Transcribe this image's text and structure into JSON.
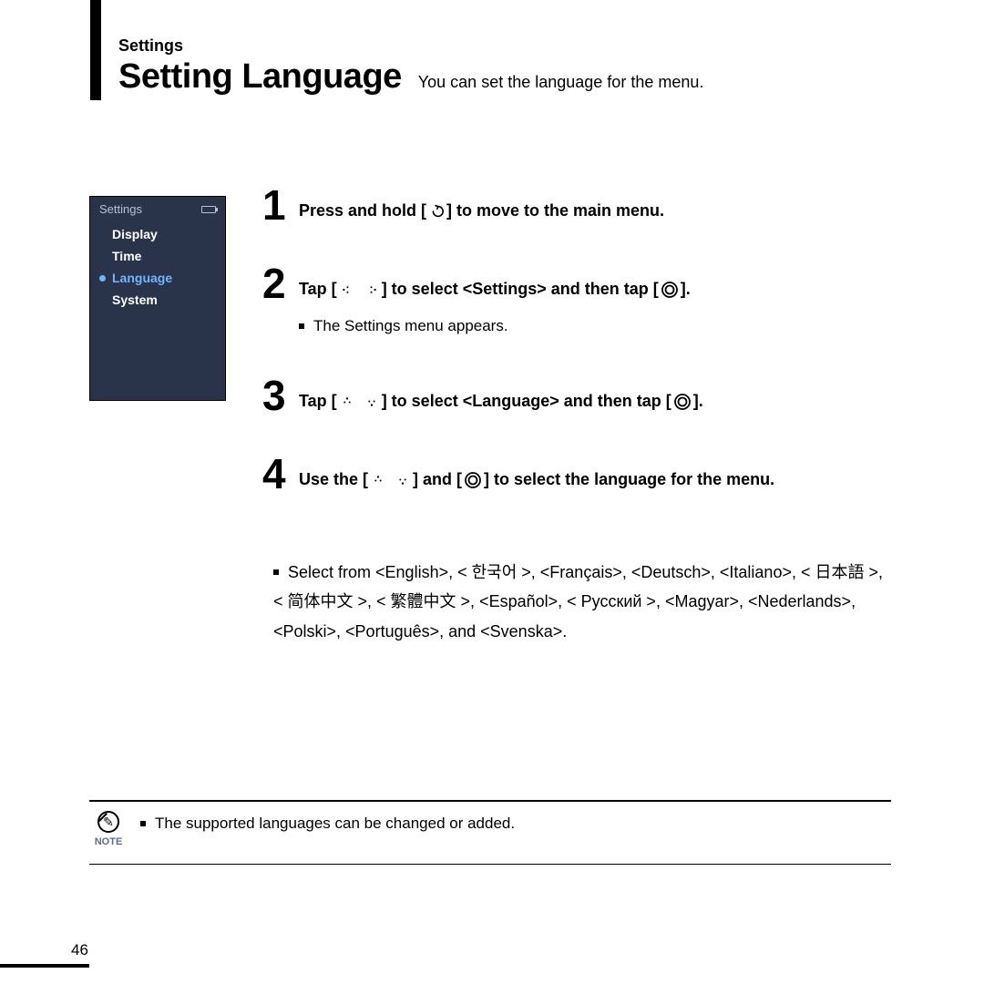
{
  "header": {
    "section_label": "Settings",
    "title": "Setting Language",
    "subtitle": "You can set the language for the menu."
  },
  "device": {
    "screen_title": "Settings",
    "items": [
      "Display",
      "Time",
      "Language",
      "System"
    ],
    "selected_index": 2
  },
  "steps": [
    {
      "num": "1",
      "head_before": "Press and hold [",
      "head_after": "] to move to the main menu.",
      "icon_seq": [
        "back-icon"
      ]
    },
    {
      "num": "2",
      "head_before": "Tap [",
      "head_mid": "] to select <Settings> and then tap [",
      "head_after": "].",
      "icon_seq": [
        "left-arrow-icon",
        "right-arrow-icon"
      ],
      "icon_tail": "ring-icon",
      "detail": "The Settings menu appears."
    },
    {
      "num": "3",
      "head_before": "Tap [",
      "head_mid": "] to select <Language> and then tap [",
      "head_after": "].",
      "icon_seq": [
        "up-arrow-icon",
        "down-arrow-icon"
      ],
      "icon_tail": "ring-icon"
    },
    {
      "num": "4",
      "head_before": "Use the [",
      "head_mid": "] and [",
      "head_after": "] to select the language for the menu.",
      "icon_seq": [
        "up-arrow-icon",
        "down-arrow-icon"
      ],
      "icon_tail": "ring-icon"
    }
  ],
  "language_block": {
    "prefix": "Select from ",
    "languages_line": "<English>, < 한국어 >, <Français>, <Deutsch>, <Italiano>, < 日本語 >, < 简体中文 >, < 繁體中文 >,  <Español>, < Русский >, <Magyar>, <Nederlands>, <Polski>, <Português>, and <Svenska>."
  },
  "note": {
    "label": "NOTE",
    "text": "The supported languages can be changed or added."
  },
  "page_number": "46"
}
